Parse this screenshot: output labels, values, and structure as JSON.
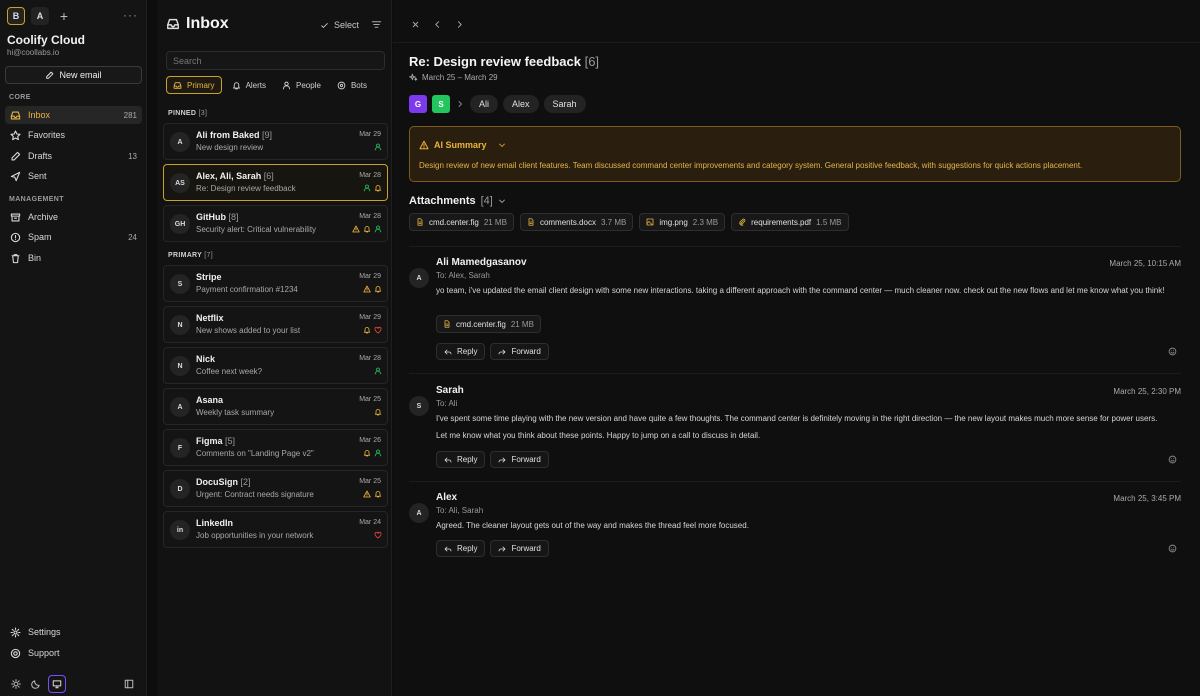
{
  "sidebar": {
    "accounts": [
      "B",
      "A"
    ],
    "brand_name": "Coolify Cloud",
    "brand_email": "hi@coollabs.io",
    "new_email_label": "New email",
    "core_label": "CORE",
    "management_label": "MANAGEMENT",
    "items": [
      {
        "label": "Inbox",
        "count": "281",
        "icon": "inbox-icon"
      },
      {
        "label": "Favorites",
        "count": "",
        "icon": "star-icon"
      },
      {
        "label": "Drafts",
        "count": "13",
        "icon": "pencil-icon"
      },
      {
        "label": "Sent",
        "count": "",
        "icon": "send-icon"
      },
      {
        "label": "Archive",
        "count": "",
        "icon": "archive-icon"
      },
      {
        "label": "Spam",
        "count": "24",
        "icon": "alert-circle-icon"
      },
      {
        "label": "Bin",
        "count": "",
        "icon": "trash-icon"
      }
    ],
    "settings_label": "Settings",
    "support_label": "Support"
  },
  "list": {
    "title": "Inbox",
    "select_label": "Select",
    "search_placeholder": "Search",
    "tabs": [
      "Primary",
      "Alerts",
      "People",
      "Bots"
    ],
    "pinned_label": "PINNED",
    "pinned_count": "[3]",
    "primary_label": "PRIMARY",
    "primary_count": "[7]",
    "pinned": [
      {
        "initials": "A",
        "sender": "Ali from Baked",
        "count": "[9]",
        "subject": "New design review",
        "date": "Mar 29",
        "flags": [
          "person"
        ]
      },
      {
        "initials": "AS",
        "sender": "Alex, Ali, Sarah",
        "count": "[6]",
        "subject": "Re: Design review feedback",
        "date": "Mar 28",
        "flags": [
          "person",
          "bell"
        ]
      },
      {
        "initials": "GH",
        "sender": "GitHub",
        "count": "[8]",
        "subject": "Security alert: Critical vulnerability",
        "date": "Mar 28",
        "flags": [
          "warning",
          "bell",
          "person"
        ]
      }
    ],
    "primary": [
      {
        "initials": "S",
        "sender": "Stripe",
        "count": "",
        "subject": "Payment confirmation #1234",
        "date": "Mar 29",
        "flags": [
          "warning",
          "bell"
        ]
      },
      {
        "initials": "N",
        "sender": "Netflix",
        "count": "",
        "subject": "New shows added to your list",
        "date": "Mar 29",
        "flags": [
          "bell",
          "heart"
        ]
      },
      {
        "initials": "N",
        "sender": "Nick",
        "count": "",
        "subject": "Coffee next week?",
        "date": "Mar 28",
        "flags": [
          "person"
        ]
      },
      {
        "initials": "A",
        "sender": "Asana",
        "count": "",
        "subject": "Weekly task summary",
        "date": "Mar 25",
        "flags": [
          "bell"
        ]
      },
      {
        "initials": "F",
        "sender": "Figma",
        "count": "[5]",
        "subject": "Comments on \"Landing Page v2\"",
        "date": "Mar 26",
        "flags": [
          "bell",
          "person"
        ]
      },
      {
        "initials": "D",
        "sender": "DocuSign",
        "count": "[2]",
        "subject": "Urgent: Contract needs signature",
        "date": "Mar 25",
        "flags": [
          "warning",
          "bell"
        ]
      },
      {
        "initials": "in",
        "sender": "LinkedIn",
        "count": "",
        "subject": "Job opportunities in your network",
        "date": "Mar 24",
        "flags": [
          "heart"
        ]
      }
    ]
  },
  "thread": {
    "title": "Re: Design review feedback",
    "count": "[6]",
    "date_range": "March 25 – March 29",
    "participant_squares": [
      {
        "letter": "G",
        "color": "#7c3aed"
      },
      {
        "letter": "S",
        "color": "#22c55e"
      }
    ],
    "participants": [
      "Ali",
      "Alex",
      "Sarah"
    ],
    "ai_summary_label": "AI Summary",
    "ai_summary_text": "Design review of new email client features. Team discussed command center improvements and category system. General positive feedback, with suggestions for quick actions placement.",
    "attachments_label": "Attachments",
    "attachments_count": "[4]",
    "attachments": [
      {
        "name": "cmd.center.fig",
        "size": "21 MB",
        "icon": "file-icon"
      },
      {
        "name": "comments.docx",
        "size": "3.7 MB",
        "icon": "file-icon"
      },
      {
        "name": "img.png",
        "size": "2.3 MB",
        "icon": "image-icon"
      },
      {
        "name": "requirements.pdf",
        "size": "1.5 MB",
        "icon": "paperclip-icon"
      }
    ],
    "reply_label": "Reply",
    "forward_label": "Forward",
    "messages": [
      {
        "initials": "A",
        "from": "Ali Mamedgasanov",
        "to": "To: Alex, Sarah",
        "when": "March 25, 10:15 AM",
        "body": [
          "yo team, i've updated the email client design with some new interactions. taking a different approach with the command center — much cleaner now. check out the new flows and let me know what you think!"
        ],
        "attachment": {
          "name": "cmd.center.fig",
          "size": "21 MB"
        }
      },
      {
        "initials": "S",
        "from": "Sarah",
        "to": "To: Ali",
        "when": "March 25, 2:30 PM",
        "body": [
          "I've spent some time playing with the new version and have quite a few thoughts. The command center is definitely moving in the right direction — the new layout makes much more sense for power users.",
          "Let me know what you think about these points. Happy to jump on a call to discuss in detail."
        ]
      },
      {
        "initials": "A",
        "from": "Alex",
        "to": "To: Ali, Sarah",
        "when": "March 25, 3:45 PM",
        "body": [
          "Agreed. The cleaner layout gets out of the way and makes the thread feel more focused."
        ]
      }
    ]
  },
  "colors": {
    "accent": "#e9b33c",
    "warning": "#e9b33c",
    "bell": "#e9b33c",
    "person": "#22c55e",
    "heart": "#ef4444"
  }
}
